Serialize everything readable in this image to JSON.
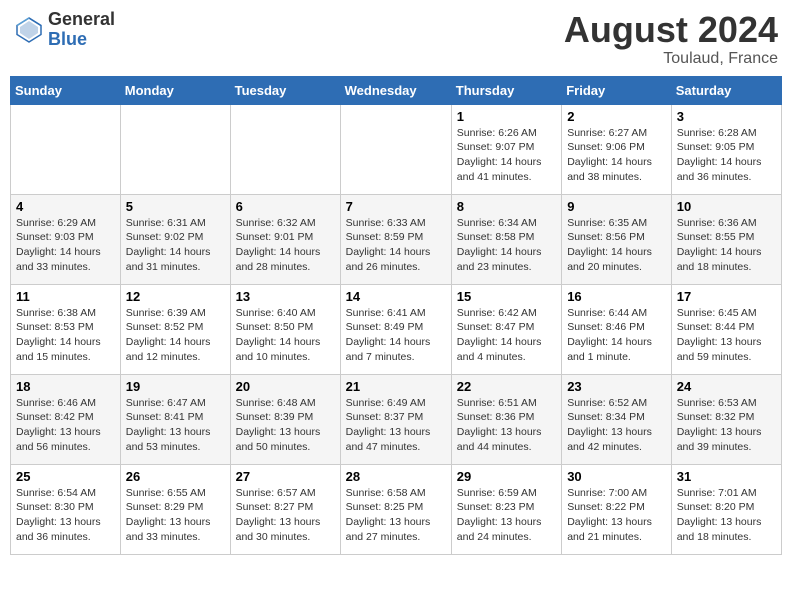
{
  "header": {
    "logo_general": "General",
    "logo_blue": "Blue",
    "month_year": "August 2024",
    "location": "Toulaud, France"
  },
  "days_of_week": [
    "Sunday",
    "Monday",
    "Tuesday",
    "Wednesday",
    "Thursday",
    "Friday",
    "Saturday"
  ],
  "weeks": [
    [
      {
        "day": "",
        "info": ""
      },
      {
        "day": "",
        "info": ""
      },
      {
        "day": "",
        "info": ""
      },
      {
        "day": "",
        "info": ""
      },
      {
        "day": "1",
        "info": "Sunrise: 6:26 AM\nSunset: 9:07 PM\nDaylight: 14 hours and 41 minutes."
      },
      {
        "day": "2",
        "info": "Sunrise: 6:27 AM\nSunset: 9:06 PM\nDaylight: 14 hours and 38 minutes."
      },
      {
        "day": "3",
        "info": "Sunrise: 6:28 AM\nSunset: 9:05 PM\nDaylight: 14 hours and 36 minutes."
      }
    ],
    [
      {
        "day": "4",
        "info": "Sunrise: 6:29 AM\nSunset: 9:03 PM\nDaylight: 14 hours and 33 minutes."
      },
      {
        "day": "5",
        "info": "Sunrise: 6:31 AM\nSunset: 9:02 PM\nDaylight: 14 hours and 31 minutes."
      },
      {
        "day": "6",
        "info": "Sunrise: 6:32 AM\nSunset: 9:01 PM\nDaylight: 14 hours and 28 minutes."
      },
      {
        "day": "7",
        "info": "Sunrise: 6:33 AM\nSunset: 8:59 PM\nDaylight: 14 hours and 26 minutes."
      },
      {
        "day": "8",
        "info": "Sunrise: 6:34 AM\nSunset: 8:58 PM\nDaylight: 14 hours and 23 minutes."
      },
      {
        "day": "9",
        "info": "Sunrise: 6:35 AM\nSunset: 8:56 PM\nDaylight: 14 hours and 20 minutes."
      },
      {
        "day": "10",
        "info": "Sunrise: 6:36 AM\nSunset: 8:55 PM\nDaylight: 14 hours and 18 minutes."
      }
    ],
    [
      {
        "day": "11",
        "info": "Sunrise: 6:38 AM\nSunset: 8:53 PM\nDaylight: 14 hours and 15 minutes."
      },
      {
        "day": "12",
        "info": "Sunrise: 6:39 AM\nSunset: 8:52 PM\nDaylight: 14 hours and 12 minutes."
      },
      {
        "day": "13",
        "info": "Sunrise: 6:40 AM\nSunset: 8:50 PM\nDaylight: 14 hours and 10 minutes."
      },
      {
        "day": "14",
        "info": "Sunrise: 6:41 AM\nSunset: 8:49 PM\nDaylight: 14 hours and 7 minutes."
      },
      {
        "day": "15",
        "info": "Sunrise: 6:42 AM\nSunset: 8:47 PM\nDaylight: 14 hours and 4 minutes."
      },
      {
        "day": "16",
        "info": "Sunrise: 6:44 AM\nSunset: 8:46 PM\nDaylight: 14 hours and 1 minute."
      },
      {
        "day": "17",
        "info": "Sunrise: 6:45 AM\nSunset: 8:44 PM\nDaylight: 13 hours and 59 minutes."
      }
    ],
    [
      {
        "day": "18",
        "info": "Sunrise: 6:46 AM\nSunset: 8:42 PM\nDaylight: 13 hours and 56 minutes."
      },
      {
        "day": "19",
        "info": "Sunrise: 6:47 AM\nSunset: 8:41 PM\nDaylight: 13 hours and 53 minutes."
      },
      {
        "day": "20",
        "info": "Sunrise: 6:48 AM\nSunset: 8:39 PM\nDaylight: 13 hours and 50 minutes."
      },
      {
        "day": "21",
        "info": "Sunrise: 6:49 AM\nSunset: 8:37 PM\nDaylight: 13 hours and 47 minutes."
      },
      {
        "day": "22",
        "info": "Sunrise: 6:51 AM\nSunset: 8:36 PM\nDaylight: 13 hours and 44 minutes."
      },
      {
        "day": "23",
        "info": "Sunrise: 6:52 AM\nSunset: 8:34 PM\nDaylight: 13 hours and 42 minutes."
      },
      {
        "day": "24",
        "info": "Sunrise: 6:53 AM\nSunset: 8:32 PM\nDaylight: 13 hours and 39 minutes."
      }
    ],
    [
      {
        "day": "25",
        "info": "Sunrise: 6:54 AM\nSunset: 8:30 PM\nDaylight: 13 hours and 36 minutes."
      },
      {
        "day": "26",
        "info": "Sunrise: 6:55 AM\nSunset: 8:29 PM\nDaylight: 13 hours and 33 minutes."
      },
      {
        "day": "27",
        "info": "Sunrise: 6:57 AM\nSunset: 8:27 PM\nDaylight: 13 hours and 30 minutes."
      },
      {
        "day": "28",
        "info": "Sunrise: 6:58 AM\nSunset: 8:25 PM\nDaylight: 13 hours and 27 minutes."
      },
      {
        "day": "29",
        "info": "Sunrise: 6:59 AM\nSunset: 8:23 PM\nDaylight: 13 hours and 24 minutes."
      },
      {
        "day": "30",
        "info": "Sunrise: 7:00 AM\nSunset: 8:22 PM\nDaylight: 13 hours and 21 minutes."
      },
      {
        "day": "31",
        "info": "Sunrise: 7:01 AM\nSunset: 8:20 PM\nDaylight: 13 hours and 18 minutes."
      }
    ]
  ]
}
